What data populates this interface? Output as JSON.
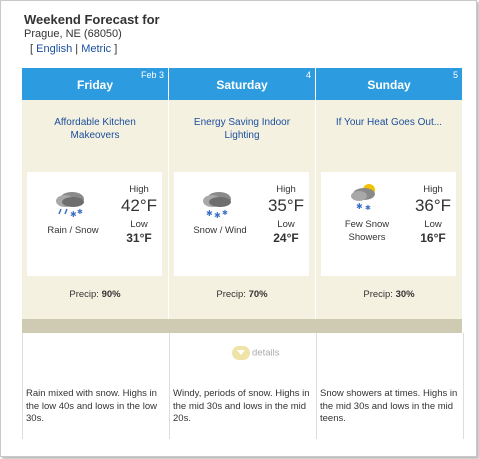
{
  "header": {
    "title": "Weekend Forecast for",
    "location": "Prague, NE (68050)",
    "bracket_open": "[",
    "english": "English",
    "separator": "|",
    "metric": "Metric",
    "bracket_close": "]"
  },
  "days": [
    {
      "name": "Friday",
      "date": "Feb 3",
      "ad": "Affordable Kitchen Makeovers",
      "condition": "Rain / Snow",
      "high_label": "High",
      "high": "42°F",
      "low_label": "Low",
      "low": "31°F",
      "precip_label": "Precip:",
      "precip": "90%",
      "description": "Rain mixed with snow. Highs in the low 40s and lows in the low 30s.",
      "icon": "rain-snow-icon"
    },
    {
      "name": "Saturday",
      "date": "4",
      "ad": "Energy Saving Indoor Lighting",
      "condition": "Snow / Wind",
      "high_label": "High",
      "high": "35°F",
      "low_label": "Low",
      "low": "24°F",
      "precip_label": "Precip:",
      "precip": "70%",
      "description": "Windy, periods of snow. Highs in the mid 30s and lows in the mid 20s.",
      "icon": "snow-wind-icon"
    },
    {
      "name": "Sunday",
      "date": "5",
      "ad": "If Your Heat Goes Out...",
      "condition": "Few Snow Showers",
      "high_label": "High",
      "high": "36°F",
      "low_label": "Low",
      "low": "16°F",
      "precip_label": "Precip:",
      "precip": "30%",
      "description": "Snow showers at times. Highs in the mid 30s and lows in the mid teens.",
      "icon": "snow-showers-icon"
    }
  ],
  "details_label": "details"
}
